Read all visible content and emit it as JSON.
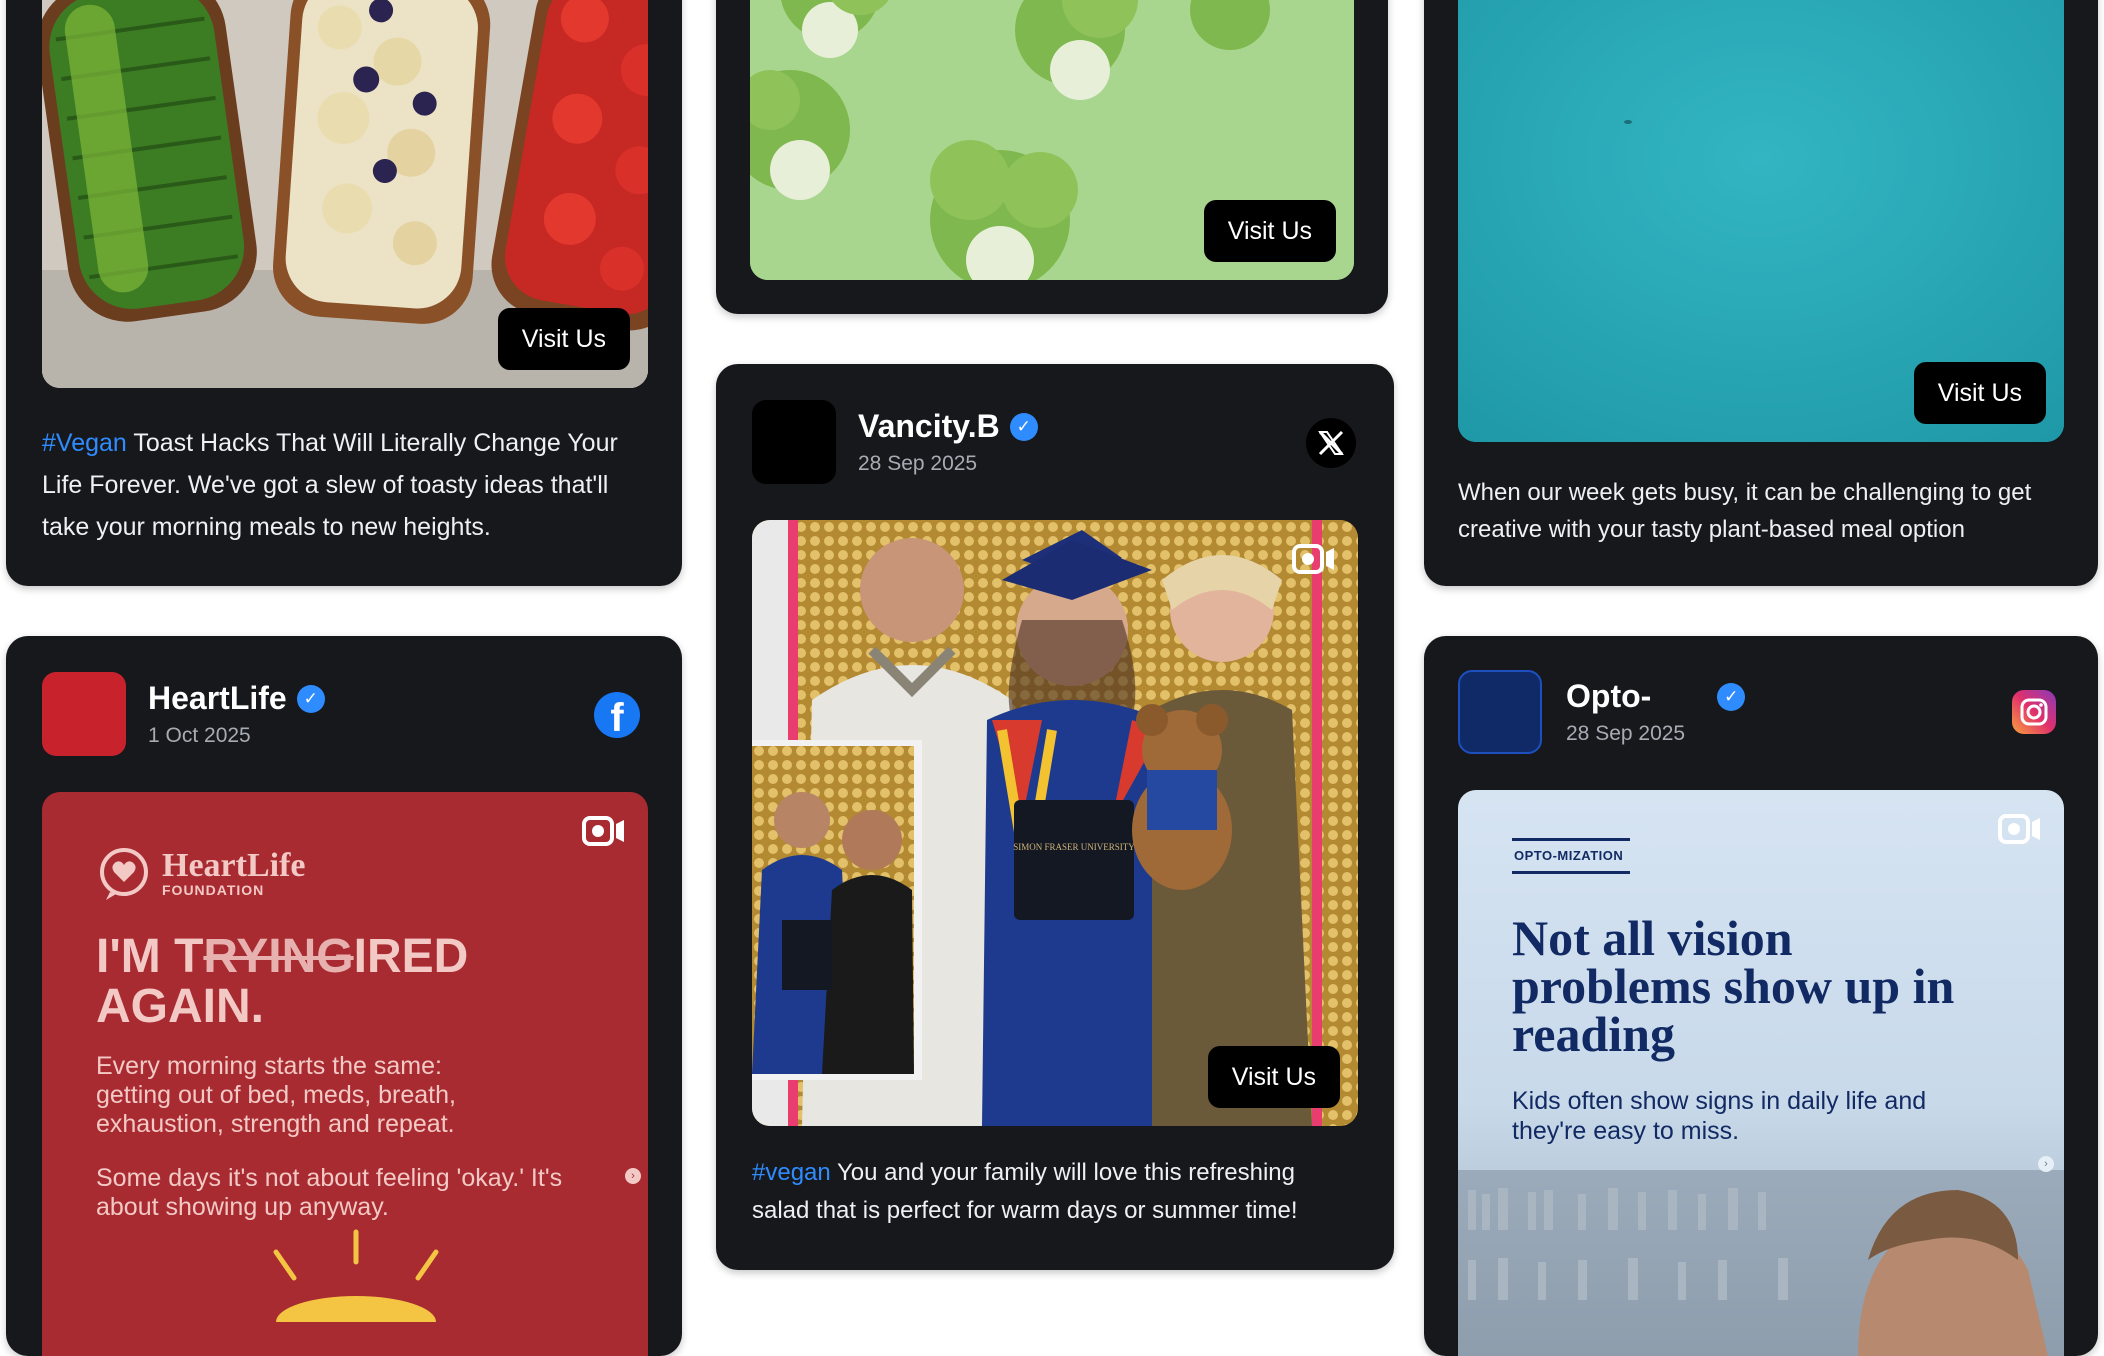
{
  "colors": {
    "card_bg": "#17181c",
    "hashtag": "#2f8cff",
    "verified": "#2f8cff",
    "heartlife_red": "#a82b32",
    "opto_navy": "#122a63"
  },
  "cards": {
    "toast": {
      "visit_label": "Visit Us",
      "hashtag": "#Vegan",
      "caption": " Toast Hacks That Will Literally Change Your Life Forever. We've got a slew of toasty ideas that'll take your morning meals to new heights."
    },
    "cauliflower": {
      "visit_label": "Visit Us"
    },
    "teal": {
      "visit_label": "Visit Us",
      "caption": "When our week gets busy, it can be challenging to get creative with your tasty plant-based meal option"
    },
    "vancity": {
      "name": "Vancity.B",
      "date": "28 Sep 2025",
      "network_icon": "x-icon",
      "visit_label": "Visit Us",
      "diploma_text": "SIMON FRASER UNIVERSITY",
      "hashtag": "#vegan",
      "caption": " You and your family will love this refreshing salad that is perfect for warm days or summer time!"
    },
    "heartlife": {
      "name": "HeartLife",
      "date": "1 Oct 2025",
      "network_icon": "facebook-icon",
      "logo_name": "HeartLife",
      "logo_sub": "FOUNDATION",
      "headline_1a": "I'M T",
      "headline_strike": "RYING",
      "headline_1b": "IRED",
      "headline_2": "AGAIN.",
      "body_1": "Every morning starts the same: getting out of bed, meds, breath, exhaustion, strength and repeat.",
      "body_2": "Some days it's not about feeling 'okay.' It's about showing up anyway."
    },
    "opto": {
      "name": "Opto-",
      "date": "28 Sep 2025",
      "network_icon": "instagram-icon",
      "badge": "OPTO-MIZATION",
      "headline": "Not all vision problems show up in reading",
      "subtext": "Kids often show signs in daily life and they're easy to miss."
    }
  }
}
